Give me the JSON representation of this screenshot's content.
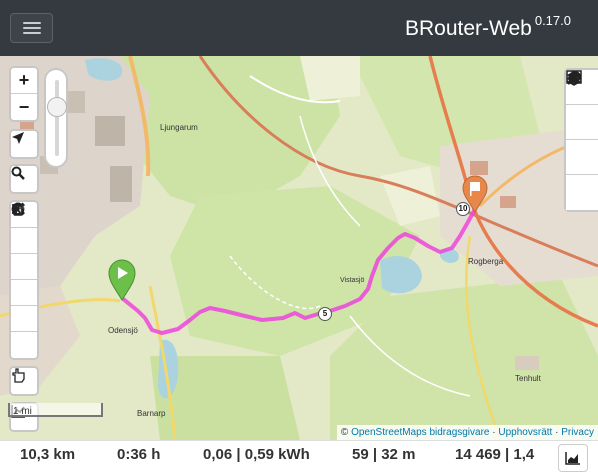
{
  "app": {
    "name": "BRouter-Web",
    "version": "0.17.0"
  },
  "navbar": {
    "menu_icon": "hamburger-icon"
  },
  "map_labels": {
    "ljungarum": "Ljungarum",
    "odensjo": "Odensjö",
    "rogberga": "Rogberga",
    "tenhult": "Tenhult",
    "barnarp": "Barnarp",
    "vistasjo": "Vistasjö"
  },
  "zoom": {
    "in_label": "+",
    "out_label": "−"
  },
  "left_tools": [
    {
      "name": "locate",
      "icon": "navigation-arrow-icon"
    },
    {
      "name": "search",
      "icon": "magnifier-icon"
    },
    {
      "name": "draw-route",
      "icon": "pencil-icon"
    },
    {
      "name": "reverse-route",
      "icon": "shuffle-icon"
    },
    {
      "name": "no-go-area",
      "icon": "no-entry-icon"
    },
    {
      "name": "circle",
      "icon": "circle-icon"
    },
    {
      "name": "beeline",
      "icon": "speaker-pin-icon"
    },
    {
      "name": "delete-route",
      "icon": "trash-icon"
    },
    {
      "name": "hint",
      "icon": "hand-pointer-icon"
    },
    {
      "name": "elevation",
      "icon": "line-chart-icon"
    }
  ],
  "right_tools": [
    {
      "name": "layers",
      "icon": "layers-icon"
    },
    {
      "name": "settings",
      "icon": "wrench-icon"
    },
    {
      "name": "data-table",
      "icon": "table-icon"
    },
    {
      "name": "stats",
      "icon": "pie-chart-icon"
    }
  ],
  "waypoints": {
    "label_5": "5",
    "label_10": "10"
  },
  "scale_label": "1 mi",
  "attribution": {
    "prefix": "©",
    "osm": "OpenStreetMaps bidragsgivare",
    "sep1": " · ",
    "imprint": "Upphovsrätt",
    "sep2": " · ",
    "privacy": "Privacy"
  },
  "stats": {
    "distance": "10,3 km",
    "time": "0:36 h",
    "energy": "0,06 | 0,59 kWh",
    "ascend": "59 | 32 m",
    "cost": "14 469 | 1,4"
  },
  "colors": {
    "route": "#ee44dd",
    "navbar": "#343a40",
    "start": "#6cc04a",
    "end": "#e8874a"
  }
}
